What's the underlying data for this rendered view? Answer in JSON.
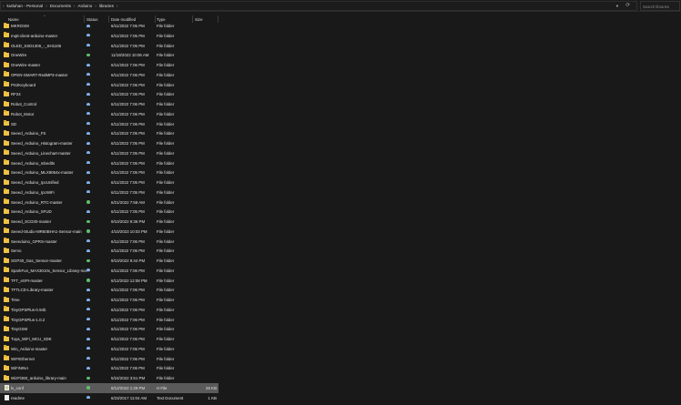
{
  "address": {
    "breadcrumb": [
      "kutluhan - Personal",
      "Documents",
      "Arduino",
      "libraries"
    ],
    "dropdown_icon": "chevron-down-icon",
    "refresh_icon": "refresh-icon"
  },
  "search": {
    "placeholder": "Search libraries"
  },
  "columns": {
    "name": "Name",
    "status": "Status",
    "date": "Date modified",
    "type": "Type",
    "size": "Size"
  },
  "colors": {
    "folder": "#f0c244",
    "synced_cloud": "#7fb0e8",
    "available_locally": "#5fbf6a",
    "selection": "#5a5a5a"
  },
  "files": [
    {
      "name": "MKRGSM",
      "status": "cloud",
      "date": "6/11/2022 7:05 PM",
      "type": "File folder",
      "size": "",
      "kind": "folder"
    },
    {
      "name": "mqtt-client-arduino-master",
      "status": "cloud",
      "date": "6/11/2022 7:05 PM",
      "type": "File folder",
      "size": "",
      "kind": "folder"
    },
    {
      "name": "OLED_SSD1306_-_SH1106",
      "status": "cloud",
      "date": "6/11/2022 7:05 PM",
      "type": "File folder",
      "size": "",
      "kind": "folder"
    },
    {
      "name": "OneWire",
      "status": "local",
      "date": "11/18/2022 10:06 AM",
      "type": "File folder",
      "size": "",
      "kind": "folder"
    },
    {
      "name": "OneWire-master",
      "status": "cloud",
      "date": "6/11/2022 7:06 PM",
      "type": "File folder",
      "size": "",
      "kind": "folder"
    },
    {
      "name": "OPEN-SMART-RedMP3-master",
      "status": "cloud",
      "date": "6/11/2022 7:06 PM",
      "type": "File folder",
      "size": "",
      "kind": "folder"
    },
    {
      "name": "PS2Keyboard",
      "status": "cloud",
      "date": "6/11/2022 7:06 PM",
      "type": "File folder",
      "size": "",
      "kind": "folder"
    },
    {
      "name": "RF24",
      "status": "cloud",
      "date": "6/11/2022 7:06 PM",
      "type": "File folder",
      "size": "",
      "kind": "folder"
    },
    {
      "name": "Robot_Control",
      "status": "cloud",
      "date": "6/11/2022 7:06 PM",
      "type": "File folder",
      "size": "",
      "kind": "folder"
    },
    {
      "name": "Robot_Motor",
      "status": "cloud",
      "date": "6/11/2022 7:06 PM",
      "type": "File folder",
      "size": "",
      "kind": "folder"
    },
    {
      "name": "SD",
      "status": "cloud",
      "date": "6/11/2022 7:06 PM",
      "type": "File folder",
      "size": "",
      "kind": "folder"
    },
    {
      "name": "Seeed_Arduino_FS",
      "status": "cloud",
      "date": "6/11/2022 7:05 PM",
      "type": "File folder",
      "size": "",
      "kind": "folder"
    },
    {
      "name": "Seeed_Arduino_Histogram-master",
      "status": "cloud",
      "date": "6/11/2022 7:05 PM",
      "type": "File folder",
      "size": "",
      "kind": "folder"
    },
    {
      "name": "Seeed_Arduino_Linechart-master",
      "status": "cloud",
      "date": "6/11/2022 7:05 PM",
      "type": "File folder",
      "size": "",
      "kind": "folder"
    },
    {
      "name": "Seeed_Arduino_mbedtls",
      "status": "cloud",
      "date": "6/11/2022 7:05 PM",
      "type": "File folder",
      "size": "",
      "kind": "folder"
    },
    {
      "name": "Seeed_Arduino_MLX9064x-master",
      "status": "cloud",
      "date": "6/11/2022 7:05 PM",
      "type": "File folder",
      "size": "",
      "kind": "folder"
    },
    {
      "name": "Seeed_Arduino_rpcUnified",
      "status": "cloud",
      "date": "6/11/2022 7:05 PM",
      "type": "File folder",
      "size": "",
      "kind": "folder"
    },
    {
      "name": "Seeed_Arduino_rpcWiFi",
      "status": "cloud",
      "date": "6/11/2022 7:05 PM",
      "type": "File folder",
      "size": "",
      "kind": "folder"
    },
    {
      "name": "Seeed_Arduino_RTC-master",
      "status": "local",
      "date": "6/21/2022 7:58 AM",
      "type": "File folder",
      "size": "",
      "kind": "folder"
    },
    {
      "name": "Seeed_Arduino_SFUD",
      "status": "cloud",
      "date": "6/11/2022 7:05 PM",
      "type": "File folder",
      "size": "",
      "kind": "folder"
    },
    {
      "name": "Seeed_SCD30-master",
      "status": "local",
      "date": "9/10/2022 9:36 PM",
      "type": "File folder",
      "size": "",
      "kind": "folder"
    },
    {
      "name": "Seeed-Studio-MR60BHA1-Sensor-main",
      "status": "local",
      "date": "4/10/2023 10:03 PM",
      "type": "File folder",
      "size": "",
      "kind": "folder"
    },
    {
      "name": "Seeeduino_GPRS-master",
      "status": "cloud",
      "date": "6/11/2022 7:06 PM",
      "type": "File folder",
      "size": "",
      "kind": "folder"
    },
    {
      "name": "Servo",
      "status": "cloud",
      "date": "6/11/2022 7:06 PM",
      "type": "File folder",
      "size": "",
      "kind": "folder"
    },
    {
      "name": "SGP30_Gas_Sensor-master",
      "status": "local",
      "date": "9/10/2022 9:44 PM",
      "type": "File folder",
      "size": "",
      "kind": "folder"
    },
    {
      "name": "SparkFun_MAX3010x_Sensor_Library-ma...",
      "status": "cloud",
      "date": "6/11/2022 7:06 PM",
      "type": "File folder",
      "size": "",
      "kind": "folder"
    },
    {
      "name": "TFT_eSPI-master",
      "status": "local",
      "date": "6/12/2022 12:08 PM",
      "type": "File folder",
      "size": "",
      "kind": "folder"
    },
    {
      "name": "TFTLCD-Library-master",
      "status": "cloud",
      "date": "6/11/2022 7:06 PM",
      "type": "File folder",
      "size": "",
      "kind": "folder"
    },
    {
      "name": "Time",
      "status": "cloud",
      "date": "6/11/2022 7:06 PM",
      "type": "File folder",
      "size": "",
      "kind": "folder"
    },
    {
      "name": "TinyGPSPlus-0.94b",
      "status": "cloud",
      "date": "6/11/2022 7:06 PM",
      "type": "File folder",
      "size": "",
      "kind": "folder"
    },
    {
      "name": "TinyGPSPlus-1.0.2",
      "status": "cloud",
      "date": "6/11/2022 7:06 PM",
      "type": "File folder",
      "size": "",
      "kind": "folder"
    },
    {
      "name": "TinyGSM",
      "status": "cloud",
      "date": "6/11/2022 7:06 PM",
      "type": "File folder",
      "size": "",
      "kind": "folder"
    },
    {
      "name": "Tuya_WiFi_MCU_SDK",
      "status": "cloud",
      "date": "6/11/2022 7:06 PM",
      "type": "File folder",
      "size": "",
      "kind": "folder"
    },
    {
      "name": "Wio_Arduino-master",
      "status": "cloud",
      "date": "6/11/2022 7:05 PM",
      "type": "File folder",
      "size": "",
      "kind": "folder"
    },
    {
      "name": "WIFIEthernet",
      "status": "cloud",
      "date": "6/11/2022 7:06 PM",
      "type": "File folder",
      "size": "",
      "kind": "folder"
    },
    {
      "name": "WiFiNINA",
      "status": "cloud",
      "date": "6/11/2022 7:06 PM",
      "type": "File folder",
      "size": "",
      "kind": "folder"
    },
    {
      "name": "WizFi360_arduino_library-main",
      "status": "local",
      "date": "5/24/2022 3:51 PM",
      "type": "File folder",
      "size": "",
      "kind": "folder"
    },
    {
      "name": "lv_conf",
      "status": "local",
      "date": "6/12/2022 1:29 PM",
      "type": "H File",
      "size": "26 KB",
      "kind": "config",
      "selected": true
    },
    {
      "name": "readme",
      "status": "cloud",
      "date": "6/23/2017 11:04 AM",
      "type": "Text Document",
      "size": "1 KB",
      "kind": "text"
    }
  ]
}
